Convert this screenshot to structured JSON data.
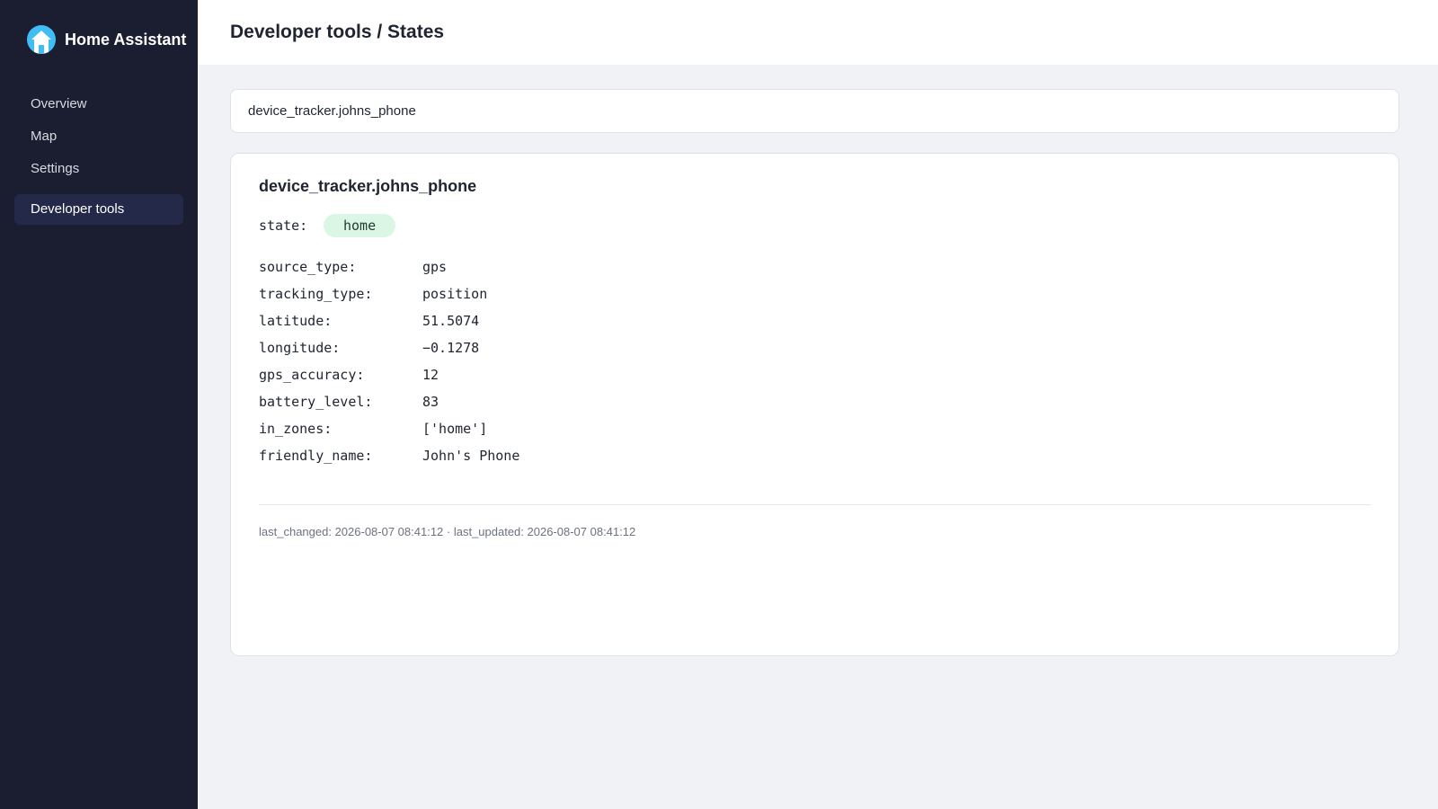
{
  "sidebar": {
    "brand": "Home Assistant",
    "items": [
      {
        "label": "Overview"
      },
      {
        "label": "Map"
      },
      {
        "label": "Settings"
      },
      {
        "label": "Developer tools",
        "active": true
      }
    ]
  },
  "header": {
    "title": "Developer tools / States"
  },
  "search": {
    "value": "device_tracker.johns_phone"
  },
  "entity": {
    "id": "device_tracker.johns_phone",
    "state_label": "state:",
    "state": "home",
    "attributes": [
      {
        "key": "source_type:",
        "value": "gps"
      },
      {
        "key": "tracking_type:",
        "value": "position"
      },
      {
        "key": "latitude:",
        "value": "51.5074"
      },
      {
        "key": "longitude:",
        "value": "−0.1278"
      },
      {
        "key": "gps_accuracy:",
        "value": "12"
      },
      {
        "key": "battery_level:",
        "value": "83"
      },
      {
        "key": "in_zones:",
        "value": "['home']"
      },
      {
        "key": "friendly_name:",
        "value": "John's Phone"
      }
    ],
    "timestamps": "last_changed: 2026-08-07 08:41:12 · last_updated: 2026-08-07 08:41:12"
  },
  "colors": {
    "sidebar_bg": "#1b1d31",
    "brand_accent": "#41bdf5",
    "state_chip_bg": "#dcf6e6"
  }
}
